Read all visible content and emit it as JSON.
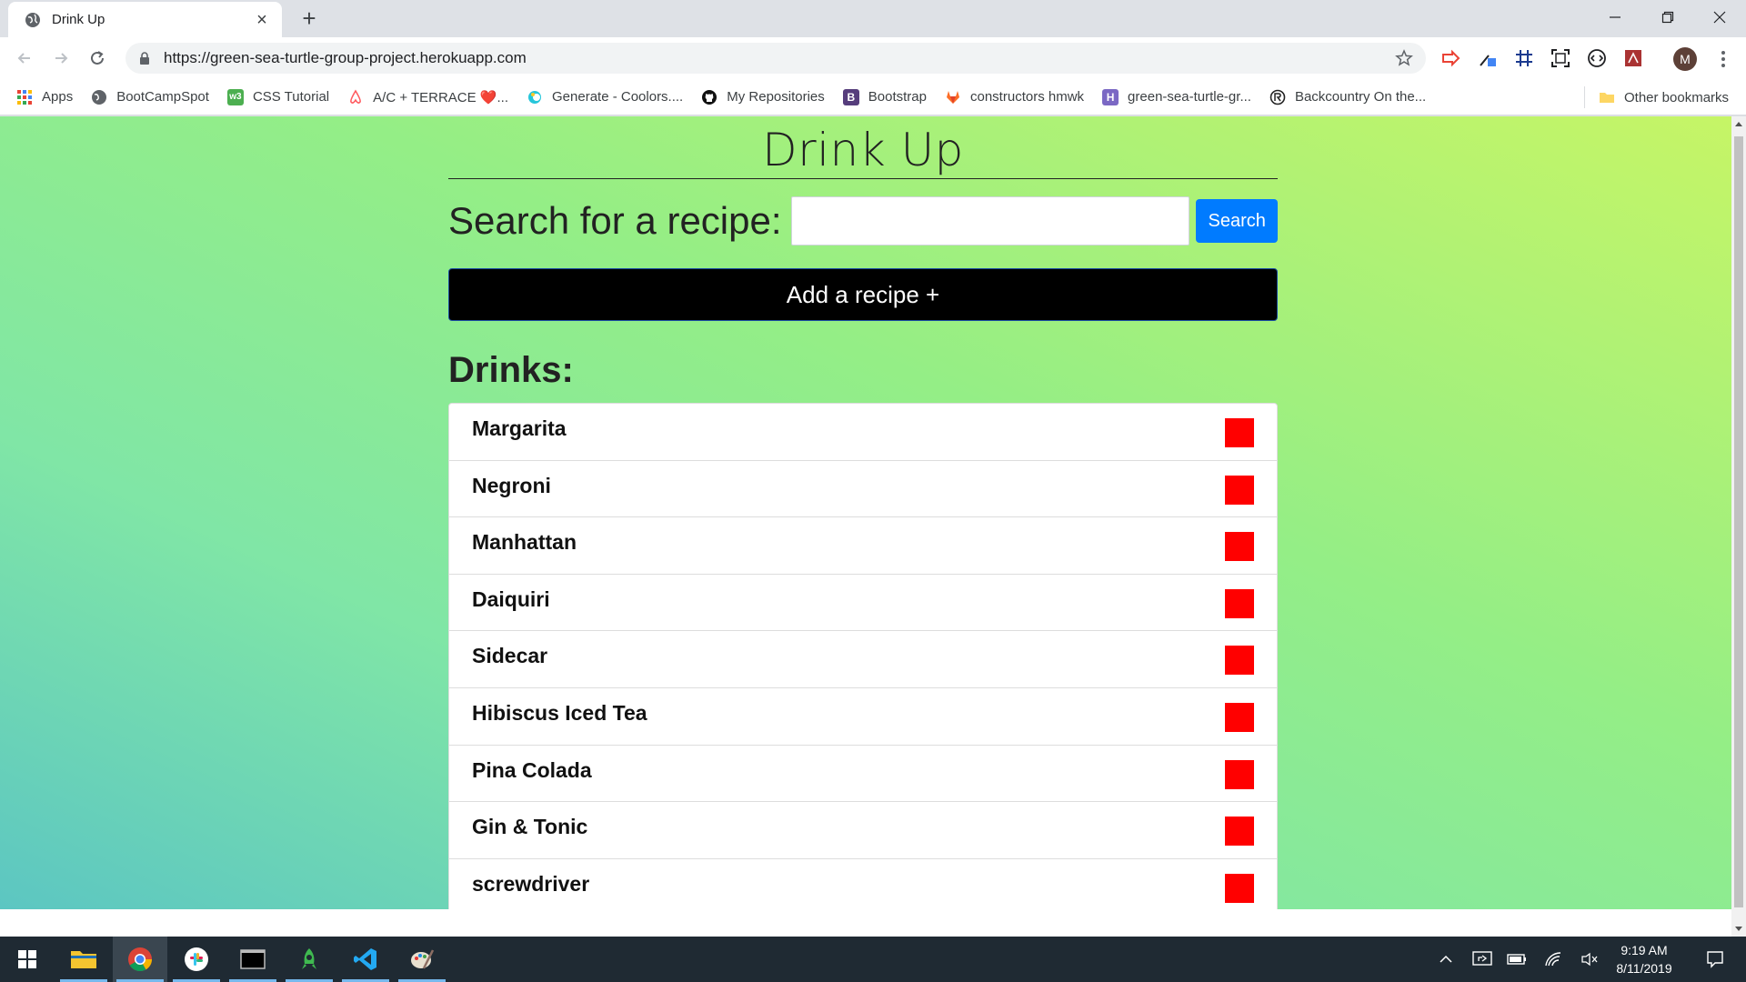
{
  "browser": {
    "tab": {
      "title": "Drink Up",
      "close": "×"
    },
    "new_tab": "+",
    "url": "https://green-sea-turtle-group-project.herokuapp.com",
    "bookmarks": [
      {
        "label": "Apps",
        "icon": "apps-grid-icon"
      },
      {
        "label": "BootCampSpot",
        "icon": "globe-icon"
      },
      {
        "label": "CSS Tutorial",
        "icon": "w3-icon"
      },
      {
        "label": "A/C + TERRACE ❤️...",
        "icon": "airbnb-icon"
      },
      {
        "label": "Generate - Coolors....",
        "icon": "coolors-icon"
      },
      {
        "label": "My Repositories",
        "icon": "github-icon"
      },
      {
        "label": "Bootstrap",
        "icon": "bootstrap-icon"
      },
      {
        "label": "constructors hmwk",
        "icon": "gitlab-icon"
      },
      {
        "label": "green-sea-turtle-gr...",
        "icon": "heroku-icon"
      },
      {
        "label": "Backcountry On the...",
        "icon": "backcountry-icon"
      }
    ],
    "other_bookmarks": "Other bookmarks",
    "avatar_letter": "M"
  },
  "page": {
    "title": "Drink Up",
    "search_label": "Search for a recipe:",
    "search_placeholder": "",
    "search_button": "Search",
    "add_button": "Add a recipe +",
    "drinks_heading": "Drinks:",
    "drinks": [
      {
        "name": "Margarita"
      },
      {
        "name": "Negroni"
      },
      {
        "name": "Manhattan"
      },
      {
        "name": "Daiquiri"
      },
      {
        "name": "Sidecar"
      },
      {
        "name": "Hibiscus Iced Tea"
      },
      {
        "name": "Pina Colada"
      },
      {
        "name": "Gin & Tonic"
      },
      {
        "name": "screwdriver"
      }
    ]
  },
  "taskbar": {
    "time": "9:19 AM",
    "date": "8/11/2019"
  },
  "colors": {
    "search_button": "#007bff",
    "delete_button": "#ff0000",
    "add_button": "#000000"
  }
}
